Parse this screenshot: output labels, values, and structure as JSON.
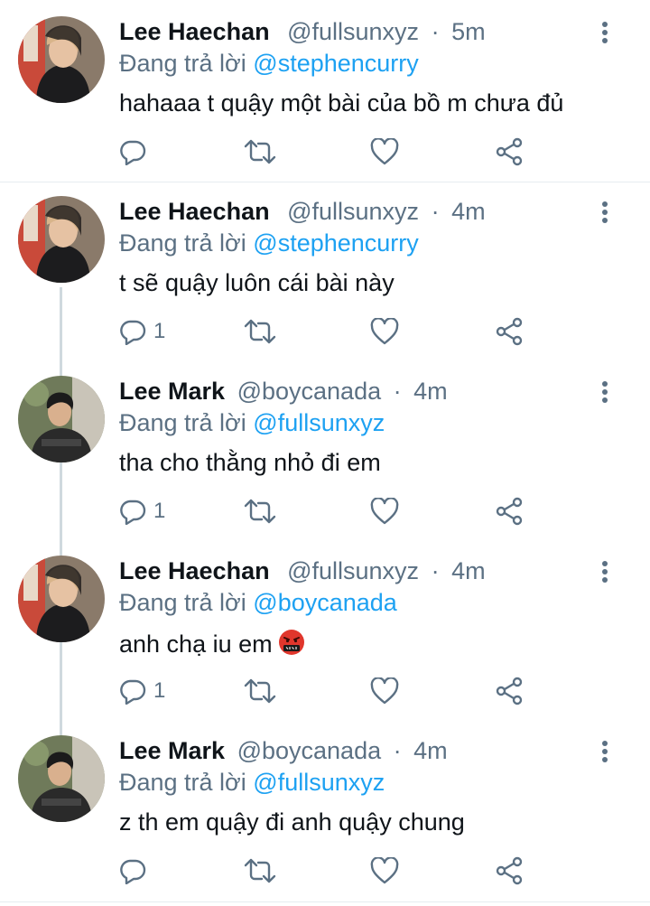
{
  "tweets": [
    {
      "name": "Lee Haechan",
      "handle": "@fullsunxyz",
      "time": "5m",
      "reply_prefix": "Đang trả lời",
      "mention": "@stephencurry",
      "text": "hahaaa t quậy một bài của bồ m chưa đủ",
      "reply_count": "",
      "avatar": "haechan"
    },
    {
      "name": "Lee Haechan",
      "handle": "@fullsunxyz",
      "time": "4m",
      "reply_prefix": "Đang trả lời",
      "mention": "@stephencurry",
      "text": "t sẽ quậy luôn cái bài này",
      "reply_count": "1",
      "avatar": "haechan"
    },
    {
      "name": "Lee Mark",
      "handle": "@boycanada",
      "time": "4m",
      "reply_prefix": "Đang trả lời",
      "mention": "@fullsunxyz",
      "text": "tha cho thằng nhỏ đi em",
      "reply_count": "1",
      "avatar": "mark"
    },
    {
      "name": "Lee Haechan",
      "handle": "@fullsunxyz",
      "time": "4m",
      "reply_prefix": "Đang trả lời",
      "mention": "@boycanada",
      "text": "anh chạ iu em",
      "reply_count": "1",
      "avatar": "haechan",
      "emoji": "angry-cursing-face"
    },
    {
      "name": "Lee Mark",
      "handle": "@boycanada",
      "time": "4m",
      "reply_prefix": "Đang trả lời",
      "mention": "@fullsunxyz",
      "text": "z th em quậy đi anh quậy chung",
      "reply_count": "",
      "avatar": "mark"
    }
  ],
  "icons": {
    "reply": "reply-icon",
    "retweet": "retweet-icon",
    "like": "like-icon",
    "share": "share-icon",
    "more": "more-icon"
  },
  "colors": {
    "mention": "#1da1f2",
    "muted": "#5b7083",
    "text": "#0f1419",
    "divider": "#e6ecf0"
  }
}
